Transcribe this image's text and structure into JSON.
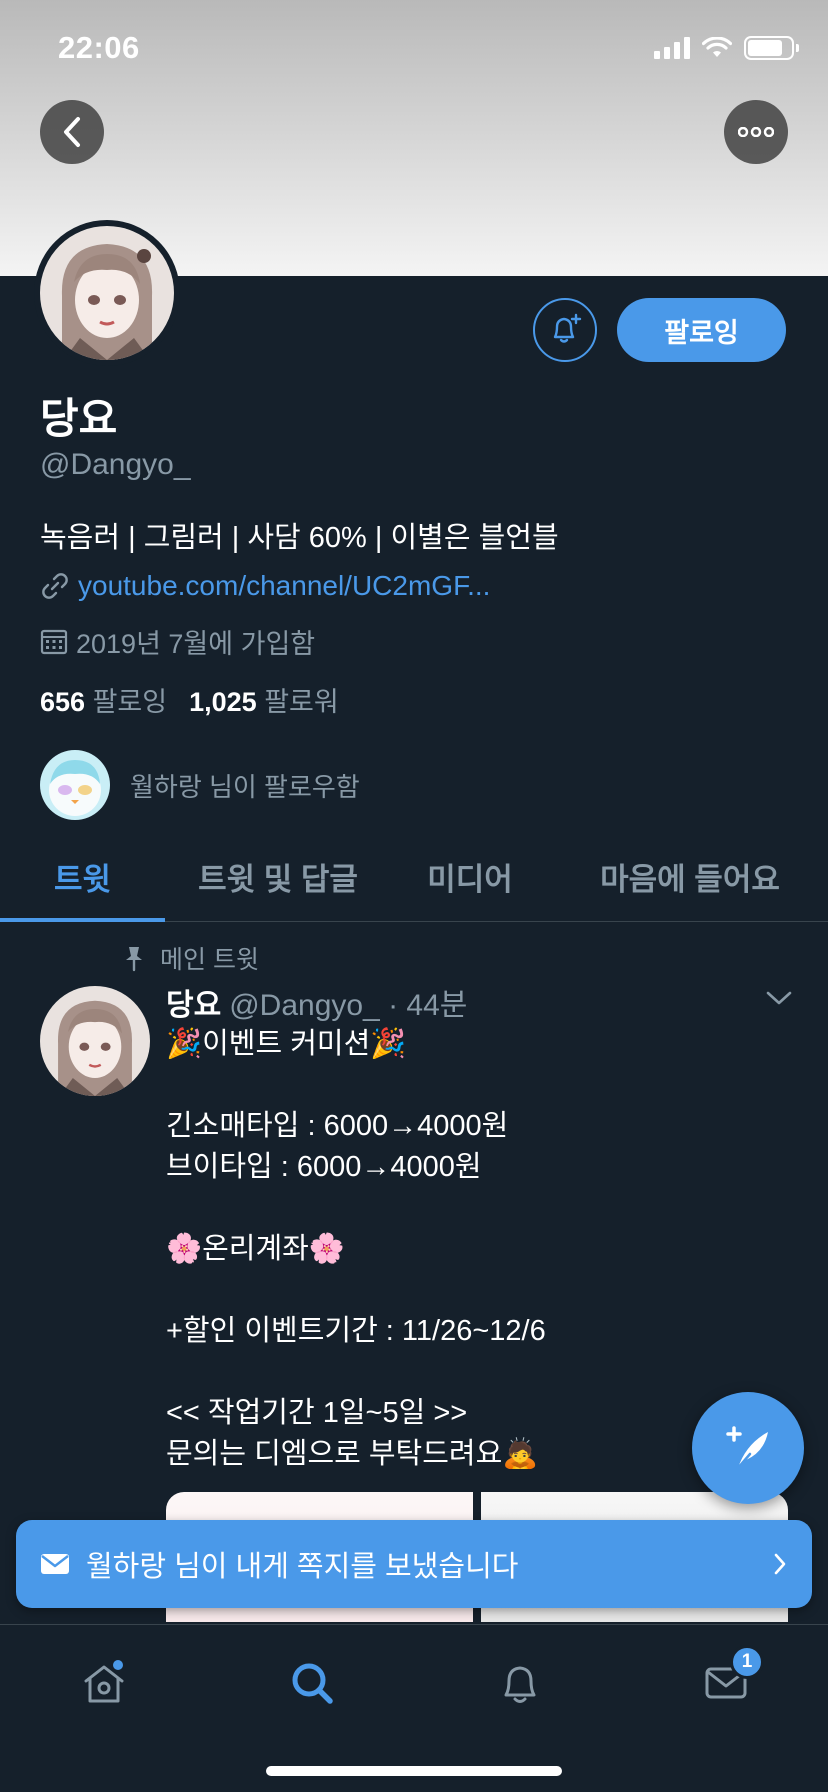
{
  "status_bar": {
    "time": "22:06"
  },
  "profile": {
    "display_name": "당요",
    "handle": "@Dangyo_",
    "bio": "녹음러 | 그림러 | 사담 60% | 이별은 블언블",
    "link": "youtube.com/channel/UC2mGF...",
    "joined": "2019년 7월에 가입함",
    "following_count": "656",
    "following_label": "팔로잉",
    "followers_count": "1,025",
    "followers_label": "팔로워",
    "follow_button_label": "팔로잉",
    "followed_by": "월하랑 님이 팔로우함"
  },
  "tabs": [
    {
      "label": "트윗",
      "active": true
    },
    {
      "label": "트윗 및 답글",
      "active": false
    },
    {
      "label": "미디어",
      "active": false
    },
    {
      "label": "마음에 들어요",
      "active": false
    }
  ],
  "tweet": {
    "pinned_label": "메인 트윗",
    "name": "당요",
    "meta": "@Dangyo_ · 44분",
    "body": "🎉이벤트 커미션🎉\n\n긴소매타입 : 6000→4000원\n브이타입 : 6000→4000원\n\n🌸온리계좌🌸\n\n+할인 이벤트기간 : 11/26~12/6\n\n<< 작업기간 1일~5일 >>\n문의는 디엠으로 부탁드려요🙇"
  },
  "toast": {
    "message": "월하랑 님이 내게 쪽지를 보냈습니다"
  },
  "bottom_nav": {
    "items": [
      "home-icon",
      "search-icon",
      "notifications-icon",
      "messages-icon"
    ],
    "messages_badge": "1"
  },
  "colors": {
    "background": "#15202b",
    "accent": "#4a99e9",
    "secondary_text": "#8899a6",
    "divider": "#38444d"
  }
}
